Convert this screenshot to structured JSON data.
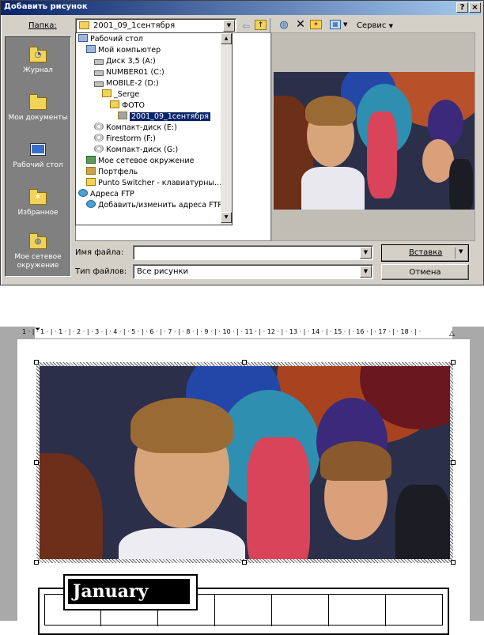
{
  "dialog": {
    "title": "Добавить рисунок",
    "title_buttons": [
      "?",
      "×"
    ],
    "folder_label": "Папка:",
    "folder_value": "2001_09_1сентября",
    "toolbar": {
      "tools_label": "Сервис"
    },
    "places": [
      {
        "label": "Журнал"
      },
      {
        "label": "Мои документы"
      },
      {
        "label": "Рабочий стол"
      },
      {
        "label": "Избранное"
      },
      {
        "label": "Мое сетевое окружение"
      }
    ],
    "tree": [
      {
        "label": "Рабочий стол",
        "icon": "desktop-icon"
      },
      {
        "label": "Мой компьютер",
        "icon": "computer-icon"
      },
      {
        "label": "Диск 3,5 (A:)",
        "icon": "floppy-icon"
      },
      {
        "label": "NUMBER01 (C:)",
        "icon": "drive-icon"
      },
      {
        "label": "MOBILE-2 (D:)",
        "icon": "drive-icon"
      },
      {
        "label": "_Serge",
        "icon": "folder-icon"
      },
      {
        "label": "ФОТО",
        "icon": "folder-icon"
      },
      {
        "label": "2001_09_1сентября",
        "icon": "folder-icon",
        "selected": true
      },
      {
        "label": "Компакт-диск (E:)",
        "icon": "cd-icon"
      },
      {
        "label": "Firestorm (F:)",
        "icon": "cd-icon"
      },
      {
        "label": "Компакт-диск (G:)",
        "icon": "cd-icon"
      },
      {
        "label": "Мое сетевое окружение",
        "icon": "network-icon"
      },
      {
        "label": "Портфель",
        "icon": "briefcase-icon"
      },
      {
        "label": "Punto Switcher - клавиатурны…",
        "icon": "folder-icon"
      },
      {
        "label": "Адреса FTP",
        "icon": "ftp-icon"
      },
      {
        "label": "Добавить/изменить адреса FTP",
        "icon": "ftp-icon"
      }
    ],
    "filename_label": "Имя файла:",
    "filename_value": "",
    "filetype_label": "Тип файлов:",
    "filetype_value": "Все рисунки",
    "insert_button": "Вставка",
    "cancel_button": "Отмена"
  },
  "document": {
    "ruler_text": "1 · | · 1 · | · 1 · | · 2 · | · 3 · | · 4 · | · 5 · | · 6 · | · 7 · | · 8 · | · 9 · | · 10 · | · 11 · | · 12 · | · 13 · | · 14 · | · 15 · | · 16 · | · 17 · | · 18 · | ·",
    "calendar_month": "January"
  }
}
